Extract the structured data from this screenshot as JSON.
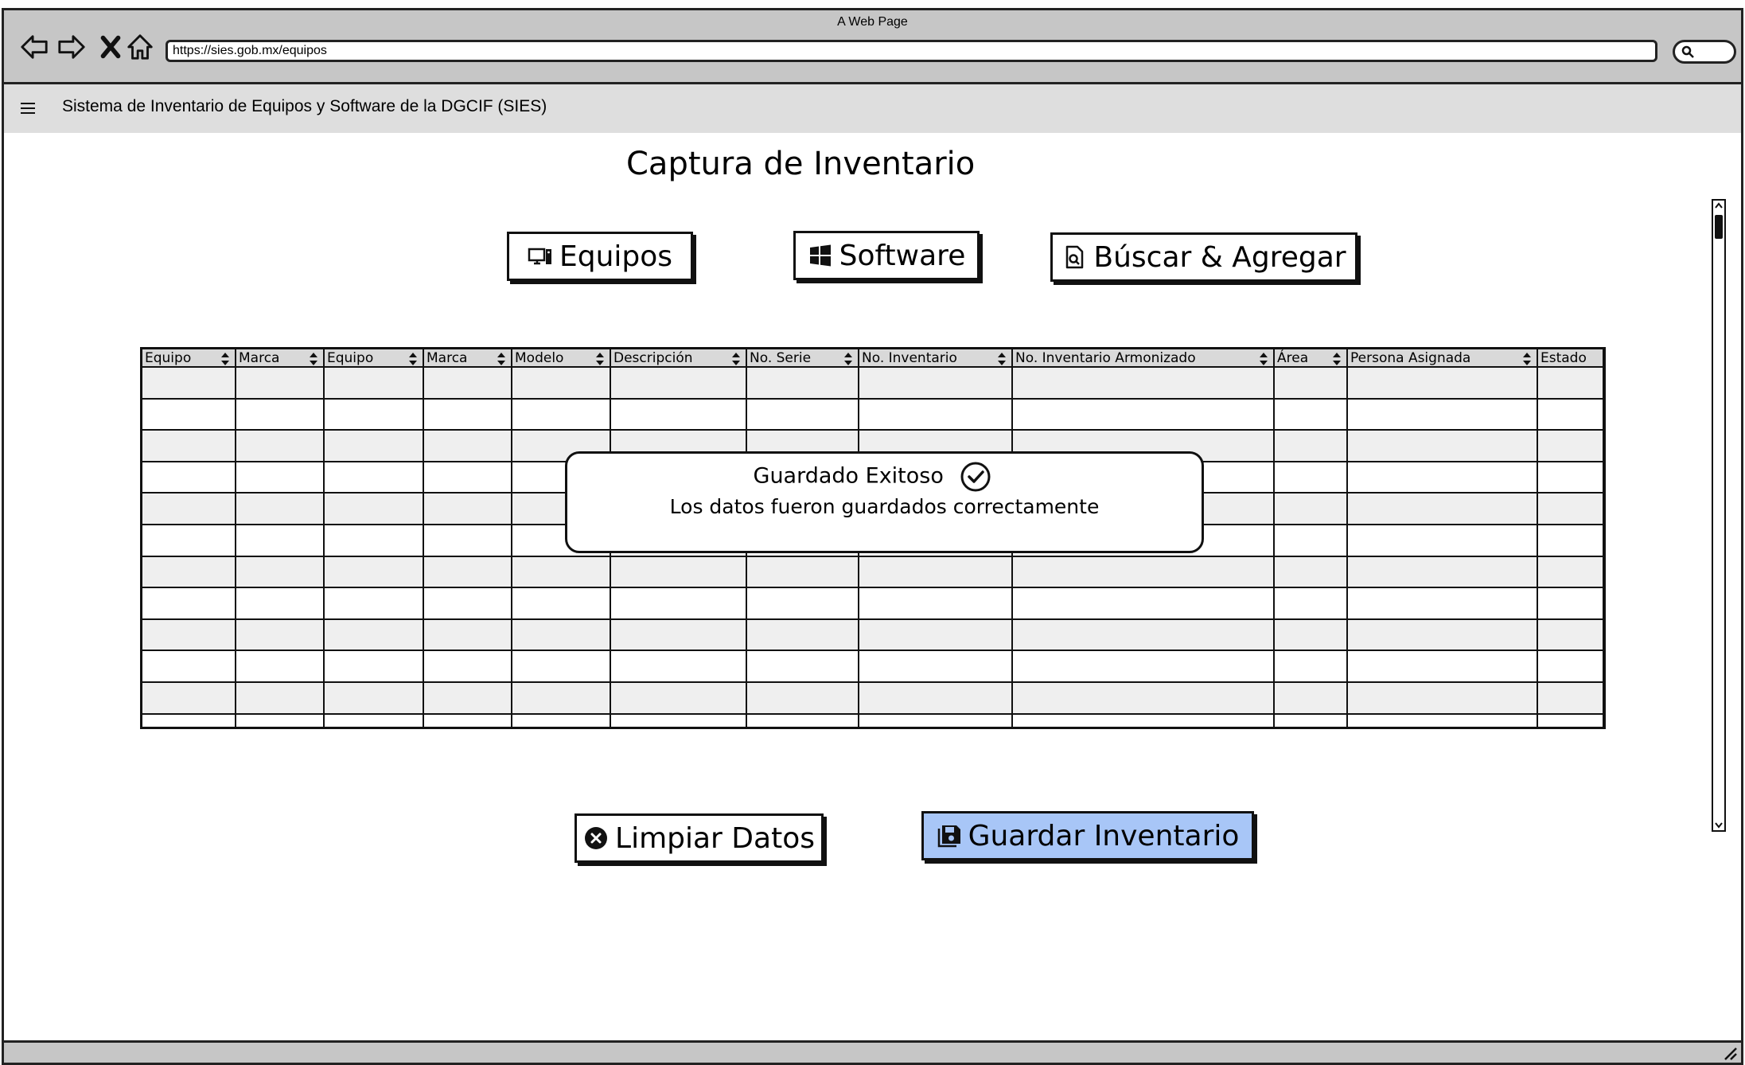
{
  "browser": {
    "window_title": "A Web Page",
    "url": "https://sies.gob.mx/equipos"
  },
  "app": {
    "title": "Sistema de Inventario de Equipos y Software de la DGCIF (SIES)"
  },
  "page": {
    "title": "Captura de Inventario"
  },
  "tabs": {
    "equipos": "Equipos",
    "software": "Software",
    "buscar": "Búscar & Agregar"
  },
  "table": {
    "columns": [
      "Equipo",
      "Marca",
      "Equipo",
      "Marca",
      "Modelo",
      "Descripción",
      "No. Serie",
      "No. Inventario",
      "No. Inventario Armonizado",
      "Área",
      "Persona Asignada",
      "Estado"
    ],
    "row_count": 12
  },
  "toast": {
    "title": "Guardado Exitoso",
    "message": "Los datos fueron guardados correctamente"
  },
  "actions": {
    "clear": "Limpiar Datos",
    "save": "Guardar Inventario"
  },
  "colors": {
    "primary_button": "#a8c6f7",
    "header_bg": "#d9d9d9",
    "alt_row": "#efefef"
  }
}
